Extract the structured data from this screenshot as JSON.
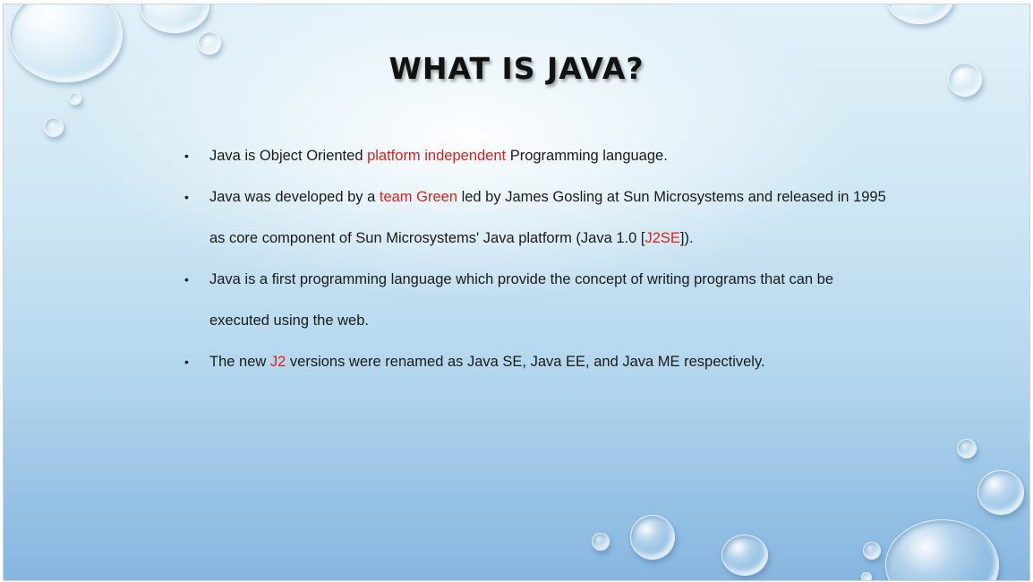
{
  "slide": {
    "title": "WHAT IS JAVA?",
    "bullet_char": "•",
    "bullets": [
      {
        "segments": [
          {
            "text": "Java is Object Oriented ",
            "color": "default"
          },
          {
            "text": "platform independent",
            "color": "red"
          },
          {
            "text": " Programming language.",
            "color": "default"
          }
        ]
      },
      {
        "segments": [
          {
            "text": "Java was developed by a ",
            "color": "default"
          },
          {
            "text": "team Green",
            "color": "red"
          },
          {
            "text": " led by James Gosling at Sun Microsystems and released in 1995 as core component of Sun Microsystems' Java platform (Java 1.0 [",
            "color": "default"
          },
          {
            "text": "J2SE",
            "color": "red"
          },
          {
            "text": "]).",
            "color": "default"
          }
        ]
      },
      {
        "segments": [
          {
            "text": "Java is a first programming language which provide the concept of writing programs that can be executed using the web.",
            "color": "default"
          }
        ]
      },
      {
        "segments": [
          {
            "text": "The new ",
            "color": "default"
          },
          {
            "text": "J2",
            "color": "red"
          },
          {
            "text": " versions were renamed as Java SE, Java EE, and Java ME respectively.",
            "color": "default"
          }
        ]
      }
    ]
  },
  "colors": {
    "highlight": "#e0201b",
    "text": "#1a1a1a",
    "background_top": "#e2f1f9",
    "background_bottom": "#86b6e0"
  }
}
